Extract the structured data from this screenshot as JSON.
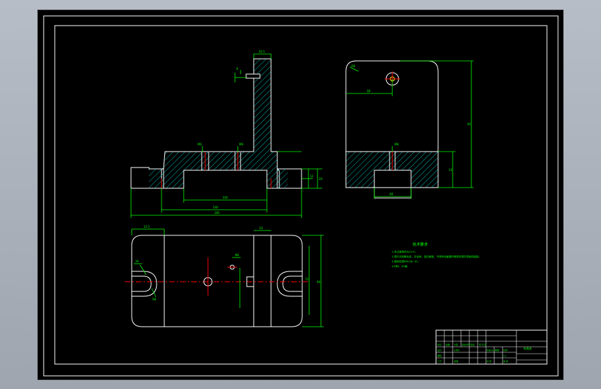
{
  "drawing": {
    "colors": {
      "background": "#000000",
      "outline": "#ffffff",
      "dimension": "#00ff00",
      "hatch": "#00c8c8",
      "centerline": "#ff0000",
      "hole": "#ffff00"
    },
    "front_view_dims": {
      "top_width": "10.5",
      "slot": "8",
      "hole_a": "M6",
      "hole_b": "M6",
      "base_height": "12",
      "total_height": "20",
      "span_inner": "100",
      "span_mid": "140",
      "span_total": "180"
    },
    "side_view_dims": {
      "radius": "R8",
      "offset": "38",
      "height": "95",
      "base": "14",
      "base_width": "60",
      "hole": "M8"
    },
    "top_view_dims": {
      "left_offset": "12.5",
      "slot_w": "16",
      "radius": "R8",
      "hole": "Φ8",
      "width_right": "24",
      "height": "90",
      "total": "72"
    },
    "notes": {
      "title": "技术要求",
      "lines": [
        "1.未注倒角均为C0.5。",
        "2.零件去除氧化皮，去毛刺，锐边倒钝，不得有划痕擦伤等损伤零件表面的缺陷。",
        "3.调质处理HRC28~32。",
        "4.材料：45钢。"
      ]
    },
    "title_block": {
      "name": "夹具体",
      "row1": [
        "标记",
        "处数",
        "分区",
        "更改文件号",
        "签名",
        "年.月.日"
      ],
      "row2": [
        "设计",
        "",
        "标准化",
        "",
        "阶段标记",
        "重量",
        "比例"
      ],
      "row3": [
        "审核",
        "",
        "",
        "",
        "",
        "",
        "1:1"
      ],
      "row4": [
        "工艺",
        "",
        "批准",
        "",
        "共 张",
        "第 张"
      ]
    }
  }
}
